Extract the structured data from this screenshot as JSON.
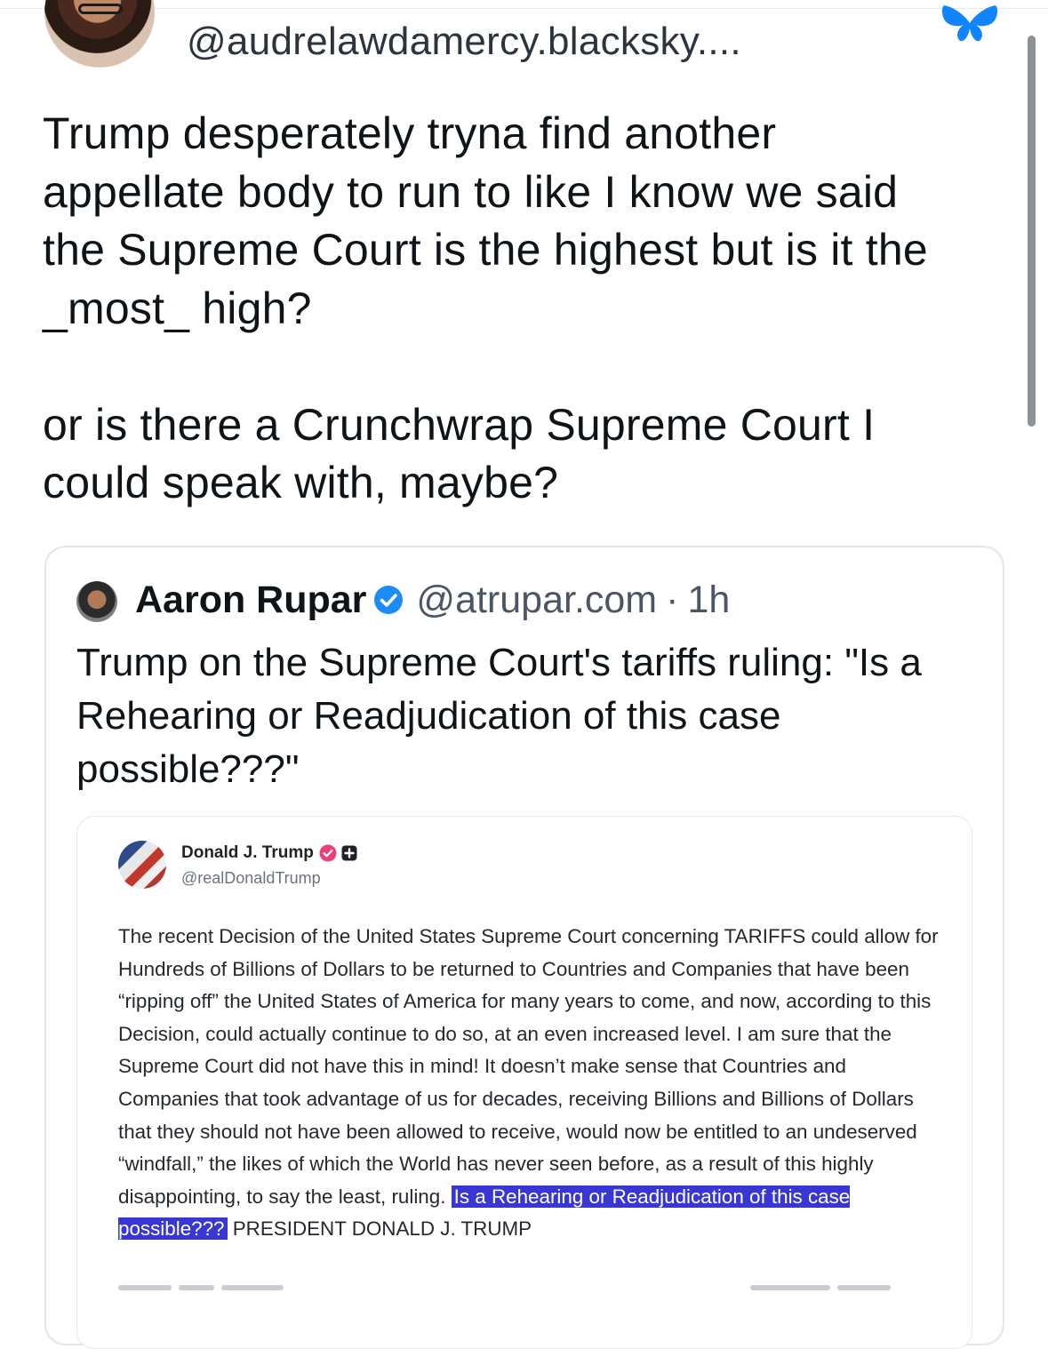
{
  "post": {
    "author_handle": "@audrelawdamercy.blacksky....",
    "text_lines": [
      "Trump desperately tryna find another",
      "appellate body to run to like I know we said",
      "the Supreme Court is the highest but is it the",
      "_most_ high?",
      "",
      "or is there a Crunchwrap Supreme Court I",
      "could speak with, maybe?"
    ]
  },
  "quote": {
    "author_name": "Aaron Rupar",
    "handle": "@atrupar.com",
    "separator": "·",
    "time": "1h",
    "text": "Trump on the Supreme Court's tariffs ruling: \"Is a Rehearing or Readjudication of this case possible???\""
  },
  "embed": {
    "author_name": "Donald J. Trump",
    "handle": "@realDonaldTrump",
    "body_plain": "The recent Decision of the United States Supreme Court concerning TARIFFS could allow for Hundreds of Billions of Dollars to be returned to Countries and Companies that have been “ripping off” the United States of America for many years to come, and now, according to this Decision, could actually continue to do so, at an even increased level. I am sure that the Supreme Court did not have this in mind! It doesn’t make sense that Countries and Companies that took advantage of us for decades, receiving Billions and Billions of Dollars that they should not have been allowed to receive, would now be entitled to an undeserved “windfall,” the likes of which the World has never seen before, as a result of this highly disappointing, to say the least, ruling.",
    "body_highlighted": "Is a Rehearing or Readjudication of this case possible???",
    "body_tail": "PRESIDENT DONALD J. TRUMP"
  },
  "colors": {
    "bluesky_brand": "#1185fe",
    "highlight": "#3936d6",
    "verified_blue": "#1d8cf8",
    "truth_verified": "#e8417a"
  },
  "icons": {
    "bluesky_logo": "butterfly-icon",
    "verified_badge": "verified-check-icon",
    "truth_badge": "verified-badge-icon"
  }
}
